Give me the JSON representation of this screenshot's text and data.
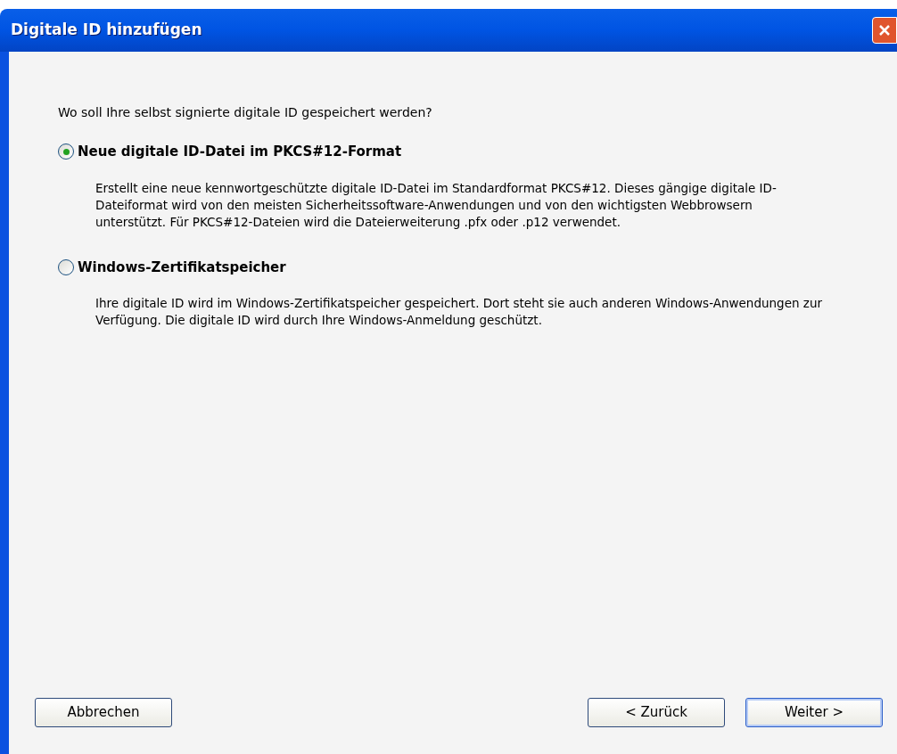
{
  "window": {
    "title": "Digitale ID hinzufügen"
  },
  "question": "Wo soll Ihre selbst signierte digitale ID gespeichert werden?",
  "options": [
    {
      "label": "Neue digitale ID-Datei im PKCS#12-Format",
      "selected": true,
      "description": "Erstellt eine neue kennwortgeschützte digitale ID-Datei im Standardformat PKCS#12. Dieses gängige digitale ID-Dateiformat wird von den meisten Sicherheitssoftware-Anwendungen und von den wichtigsten Webbrowsern unterstützt. Für PKCS#12-Dateien wird die Dateierweiterung .pfx oder .p12 verwendet."
    },
    {
      "label": "Windows-Zertifikatspeicher",
      "selected": false,
      "description": "Ihre digitale ID wird im Windows-Zertifikatspeicher gespeichert. Dort steht sie auch anderen Windows-Anwendungen zur Verfügung. Die digitale ID wird durch Ihre Windows-Anmeldung geschützt."
    }
  ],
  "buttons": [
    {
      "label": "Abbrechen",
      "kind": "cancel"
    },
    {
      "label": "< Zurück",
      "kind": "back"
    },
    {
      "label": "Weiter >",
      "kind": "default"
    }
  ]
}
